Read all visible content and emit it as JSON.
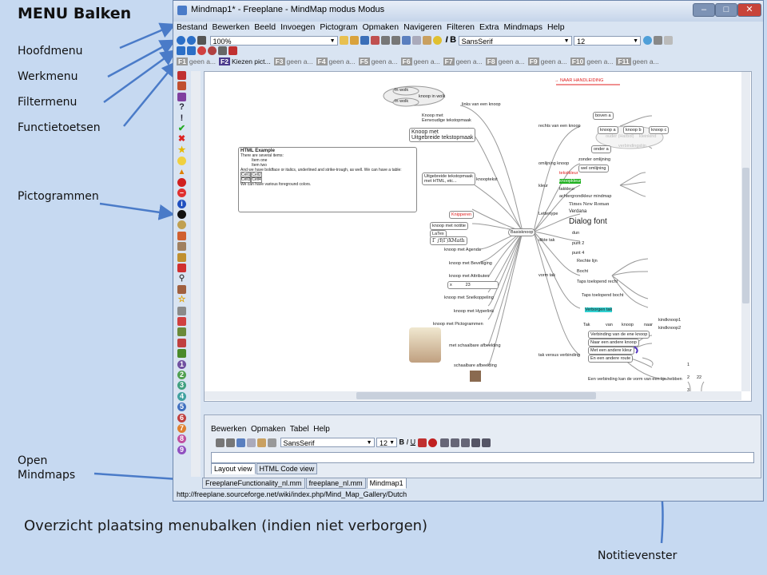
{
  "slide_title": "MENU Balken",
  "labels": {
    "hoofdmenu": "Hoofdmenu",
    "werkmenu": "Werkmenu",
    "filtermenu": "Filtermenu",
    "functietoetsen": "Functietoetsen",
    "pictogrammen": "Pictogrammen",
    "open_mindmaps": "Open\nMindmaps",
    "notes": "Notitievenster"
  },
  "caption": "Overzicht plaatsing menubalken (indien niet verborgen)",
  "window": {
    "title": "Mindmap1* - Freeplane - MindMap modus Modus",
    "buttons": [
      "–",
      "□",
      "✕"
    ]
  },
  "menu": [
    "Bestand",
    "Bewerken",
    "Beeld",
    "Invoegen",
    "Pictogram",
    "Opmaken",
    "Navigeren",
    "Filteren",
    "Extra",
    "Mindmaps",
    "Help"
  ],
  "toolbar": {
    "zoom": "100%",
    "font": "SansSerif",
    "size": "12"
  },
  "fkeys": {
    "items": [
      "geen a...",
      "Kiezen pict...",
      "geen a...",
      "geen a...",
      "geen a...",
      "geen a...",
      "geen a...",
      "geen a...",
      "geen a...",
      "geen a...",
      "geen a..."
    ],
    "numbers": [
      "F1",
      "F2",
      "F3",
      "F4",
      "F5",
      "F6",
      "F7",
      "F8",
      "F9",
      "F10",
      "F11"
    ]
  },
  "map": {
    "root": "Basisknoop",
    "link": "→ NAAR HANDLEIDING",
    "html_title": "HTML Example",
    "html_text1": "There are several items:",
    "html_item1": "Item one",
    "html_item2": "Item two",
    "html_text2": "And we have boldface or italics, underlined and strike-trough, as well. We can have a table:",
    "html_cells": [
      "Cell1",
      "Cell2",
      "Cell3",
      "Cell4"
    ],
    "html_text3": "We can have various foreground colors.",
    "left": [
      "links van een knoop",
      "Knoop met\nEenvoudige tekstopmaak",
      "Knoop met\nUitgebreide tekstopmaak",
      "Uitgebreide tekstopmaak\nmet HTML, etc...",
      "knooptekst",
      "Knipperen",
      "knoop met notitie",
      "LaTex",
      "knoop met Agenda",
      "knoop met Beveiliging",
      "knoop met Attributen",
      "knoop met Snelkoppeling",
      "knoop met Hyperlink",
      "knoop met Pictogrammen",
      "met schaalbare afbeelding",
      "schaalbare afbeelding"
    ],
    "attr": [
      "x",
      "23"
    ],
    "right": [
      "rechts van een knoop",
      "omlijning knoop",
      "kleur",
      "Lettertype",
      "dikte tak",
      "vorm tak",
      "Verborgen tak",
      "tak versus verbinding"
    ],
    "leaves": [
      "boven a",
      "knoop a",
      "knoop b",
      "knoop c",
      "onder a",
      "zonder omlijning",
      "wel omlijning",
      "tekstkleur",
      "knoopkleur",
      "takkleur",
      "achtergrondkleur mindmap",
      "Times New Roman",
      "Verdana",
      "Dialog font",
      "dun",
      "punt 2",
      "punt 4",
      "Rechte lijn",
      "Bocht",
      "Taps toelopend recht",
      "Taps toelopend bocht",
      "Tak",
      "van",
      "knoop",
      "naar",
      "kindknoop1",
      "kindknoop2",
      "Verbinding van de ene knoop",
      "Naar een andere knoop",
      "Met een andere kleur",
      "En een andere route",
      "Een verbinding kan de vorm van een lijn hebben",
      "1",
      "2",
      "3",
      "22",
      "In wolk",
      "In wolk",
      "knoop in wolk",
      "ouder (Harbol)",
      "kleinkind",
      "verbindingslijn"
    ]
  },
  "notes": {
    "menu": [
      "Bewerken",
      "Opmaken",
      "Tabel",
      "Help"
    ],
    "font": "SansSerif",
    "size": "12",
    "views": [
      "Layout view",
      "HTML Code view"
    ]
  },
  "tabs": [
    "FreeplaneFunctionality_nl.mm",
    "freeplane_nl.mm",
    "Mindmap1"
  ],
  "status": "http://freeplane.sourceforge.net/wiki/index.php/Mind_Map_Gallery/Dutch",
  "colors": {
    "arrow": "#4a7bc8",
    "window_bg": "#d9e4f2"
  }
}
